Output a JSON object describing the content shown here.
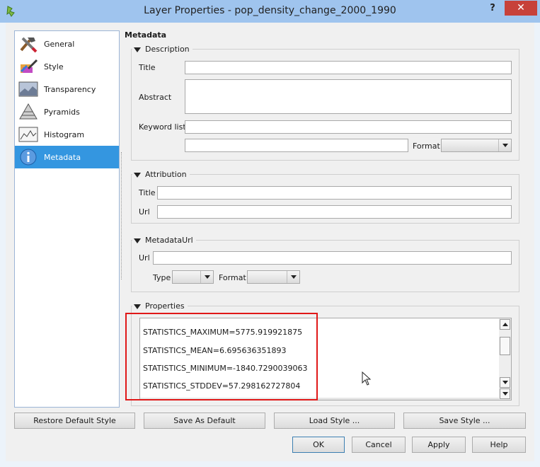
{
  "window": {
    "title": "Layer Properties - pop_density_change_2000_1990",
    "help_label": "?",
    "close_label": "✕"
  },
  "sidebar": {
    "items": [
      {
        "label": "General",
        "icon": "tools-icon"
      },
      {
        "label": "Style",
        "icon": "paintbrush-icon"
      },
      {
        "label": "Transparency",
        "icon": "transparency-icon"
      },
      {
        "label": "Pyramids",
        "icon": "pyramid-icon"
      },
      {
        "label": "Histogram",
        "icon": "histogram-icon"
      },
      {
        "label": "Metadata",
        "icon": "info-icon",
        "selected": true
      }
    ]
  },
  "main": {
    "section_title": "Metadata",
    "description": {
      "header": "Description",
      "title_label": "Title",
      "title_value": "",
      "abstract_label": "Abstract",
      "abstract_value": "",
      "keyword_label": "Keyword list",
      "keyword_value": "",
      "extra_value": "",
      "format_label": "Format",
      "format_value": ""
    },
    "attribution": {
      "header": "Attribution",
      "title_label": "Title",
      "title_value": "",
      "url_label": "Url",
      "url_value": ""
    },
    "metadata_url": {
      "header": "MetadataUrl",
      "url_label": "Url",
      "url_value": "",
      "type_label": "Type",
      "type_value": "",
      "format_label": "Format",
      "format_value": ""
    },
    "properties": {
      "header": "Properties",
      "lines": [
        "STATISTICS_MAXIMUM=5775.919921875",
        "STATISTICS_MEAN=6.695636351893",
        "STATISTICS_MINIMUM=-1840.7290039063",
        "STATISTICS_STDDEV=57.298162727804"
      ]
    }
  },
  "buttons": {
    "restore_default": "Restore Default Style",
    "save_default": "Save As Default",
    "load_style": "Load Style ...",
    "save_style": "Save Style ...",
    "ok": "OK",
    "cancel": "Cancel",
    "apply": "Apply",
    "help": "Help"
  },
  "colors": {
    "titlebar": "#9fc4ee",
    "close": "#c7413a",
    "selection": "#3496e0",
    "highlight": "#e01818"
  }
}
